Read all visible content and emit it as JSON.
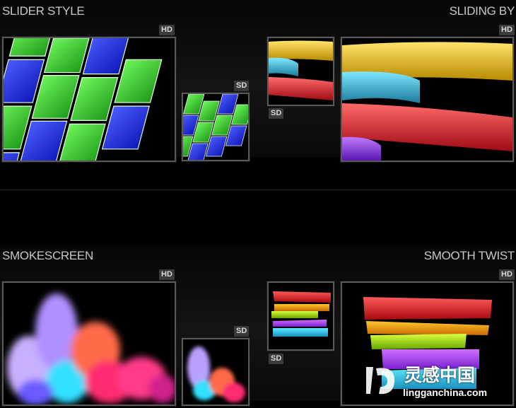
{
  "sections": [
    {
      "title": "SLIDER STYLE",
      "hd_badge": "HD",
      "sd_badge": "SD"
    },
    {
      "title": "SLIDING BY",
      "hd_badge": "HD",
      "sd_badge": "SD"
    },
    {
      "title": "SMOKESCREEN",
      "hd_badge": "HD",
      "sd_badge": "SD"
    },
    {
      "title": "SMOOTH TWIST",
      "hd_badge": "HD",
      "sd_badge": "SD"
    }
  ],
  "watermark": {
    "chinese": "灵感中国",
    "url": "lingganchina.com"
  },
  "colors": {
    "frame": "#5a5a5a",
    "badge_bg": "#3a3a3a",
    "title": "#c8c8c8"
  }
}
